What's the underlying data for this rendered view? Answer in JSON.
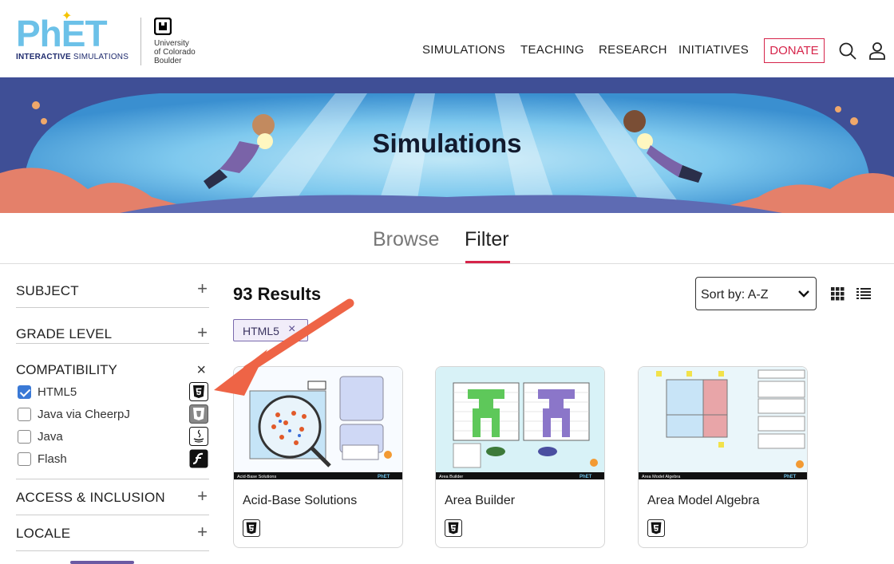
{
  "header": {
    "logo_text": "PhET",
    "logo_tagline_bold": "INTERACTIVE",
    "logo_tagline": " SIMULATIONS",
    "university_line1": "University",
    "university_line2": "of Colorado",
    "university_line3": "Boulder",
    "nav": [
      "SIMULATIONS",
      "TEACHING",
      "RESEARCH",
      "INITIATIVES"
    ],
    "donate_label": "DONATE",
    "icons": {
      "search": "search-icon",
      "account": "user-icon"
    }
  },
  "hero": {
    "title": "Simulations"
  },
  "tabs": {
    "browse": "Browse",
    "filter": "Filter",
    "active": "Filter"
  },
  "sidebar": {
    "subject": "SUBJECT",
    "grade_level": "GRADE LEVEL",
    "compatibility": "COMPATIBILITY",
    "compat_options": [
      {
        "label": "HTML5",
        "checked": true,
        "icon": "html5-icon"
      },
      {
        "label": "Java via CheerpJ",
        "checked": false,
        "icon": "cheerpj-icon"
      },
      {
        "label": "Java",
        "checked": false,
        "icon": "java-icon"
      },
      {
        "label": "Flash",
        "checked": false,
        "icon": "flash-icon"
      }
    ],
    "access_inclusion": "ACCESS & INCLUSION",
    "locale": "LOCALE",
    "expand_symbol": "+",
    "collapse_symbol": "×"
  },
  "results": {
    "count_label": "93 Results",
    "sort_label": "Sort by:  A-Z",
    "active_filter": "HTML5",
    "filter_remove": "×"
  },
  "cards": [
    {
      "title": "Acid-Base Solutions",
      "footer_label": "Acid-Base Solutions",
      "compat": "html5-icon"
    },
    {
      "title": "Area Builder",
      "footer_label": "Area Builder",
      "compat": "html5-icon"
    },
    {
      "title": "Area Model Algebra",
      "footer_label": "Area Model Algebra",
      "compat": "html5-icon"
    }
  ],
  "colors": {
    "accent": "#d6244a",
    "phet_blue": "#6cc1e8",
    "checkbox_blue": "#3a79d6",
    "chip_border": "#7a6aae",
    "annotation_arrow": "#ee6446"
  }
}
